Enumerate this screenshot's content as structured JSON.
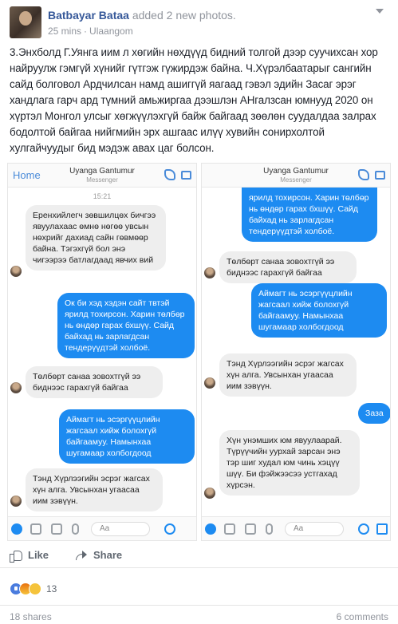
{
  "post": {
    "author": "Batbayar Bataa",
    "action": "added 2 new photos.",
    "time": "25 mins",
    "location": "Ulaangom",
    "text": "3.Энхболд Г.Уянга иим л хөгийн нөхдүүд бидний толгой дээр суучихсан хор найруулж гэмгүй хүнийг гүтгэж гүжирдэж байна. Ч.Хүрэлбаатарыг сангийн сайд болговол Ардчилсан намд ашиггүй яагаад гэвэл эдийн Засаг эрэг хандлага гарч ард түмний амьжиргаа дээшлэн АНгалзсан юмнууд 2020 он хүртэл Монгол улсыг хөгжүүлэхгүй байж байгаад зөөлөн суудалдаа залрах бодолтой байгаа нийгмийн эрх ашгаас илүү хувийн сонирхолтой хулгайчуудыг бид мэдэж авах цаг болсон."
  },
  "messenger": {
    "home": "Home",
    "contact": "Uyanga Gantumur",
    "subtitle": "Messenger",
    "timestamp": "15:21",
    "input_placeholder": "Aa"
  },
  "left_messages": [
    "Еренхийлегч зөвшилцөх бичгээ явуулахаас өмнө нөгөө увсын нөхрийг дахиад сайн гөвмөөр байна. Тэгэхгүй бол энэ чигээрээ батлагдаад явчих вий",
    "Ок би хэд хэдэн сайт твтэй ярилд тохирсон. Харин төлбөр нь өндөр гарах бхшүү. Сайд байхад нь зарлагдсан тендерүүдтэй холбоё.",
    "Төлбөрт санаа зовохтгүй ээ биднээс гарахгүй байгаа",
    "Аймагт нь эсэргүүцлийн жагсаал хийж болохгүй байгаамуу. Намынхаа шугамаар холбогдоод",
    "Тэнд Хүрлээгийн эсрэг жагсах хүн алга. Увсынхан угаасаа иим зэвүүн."
  ],
  "right_messages": [
    "ярилд тохирсон. Харин төлбөр нь өндөр гарах бхшүү. Сайд байхад нь зарлагдсан тендерүүдтэй холбоё.",
    "Төлбөрт санаа зовохтгүй ээ биднээс гарахгүй байгаа",
    "Аймагт нь эсэргүүцлийн жагсаал хийж болохгүй байгаамуу. Намынхаа шугамаар холбогдоод",
    "Тэнд Хүрлээгийн эсрэг жагсах хүн алга. Увсынхан угаасаа иим зэвүүн.",
    "Заза",
    "Хүн унэмших юм явуулаарай. Түрүүчийн уурхай зарсан энэ тэр шиг худал юм чинь хэцүү шүү. Би фэйжээсээ устгахад хүрсэн."
  ],
  "actions": {
    "like": "Like",
    "share": "Share"
  },
  "reactions": {
    "count": "13"
  },
  "footer": {
    "shares": "18 shares",
    "comments": "6 comments"
  }
}
